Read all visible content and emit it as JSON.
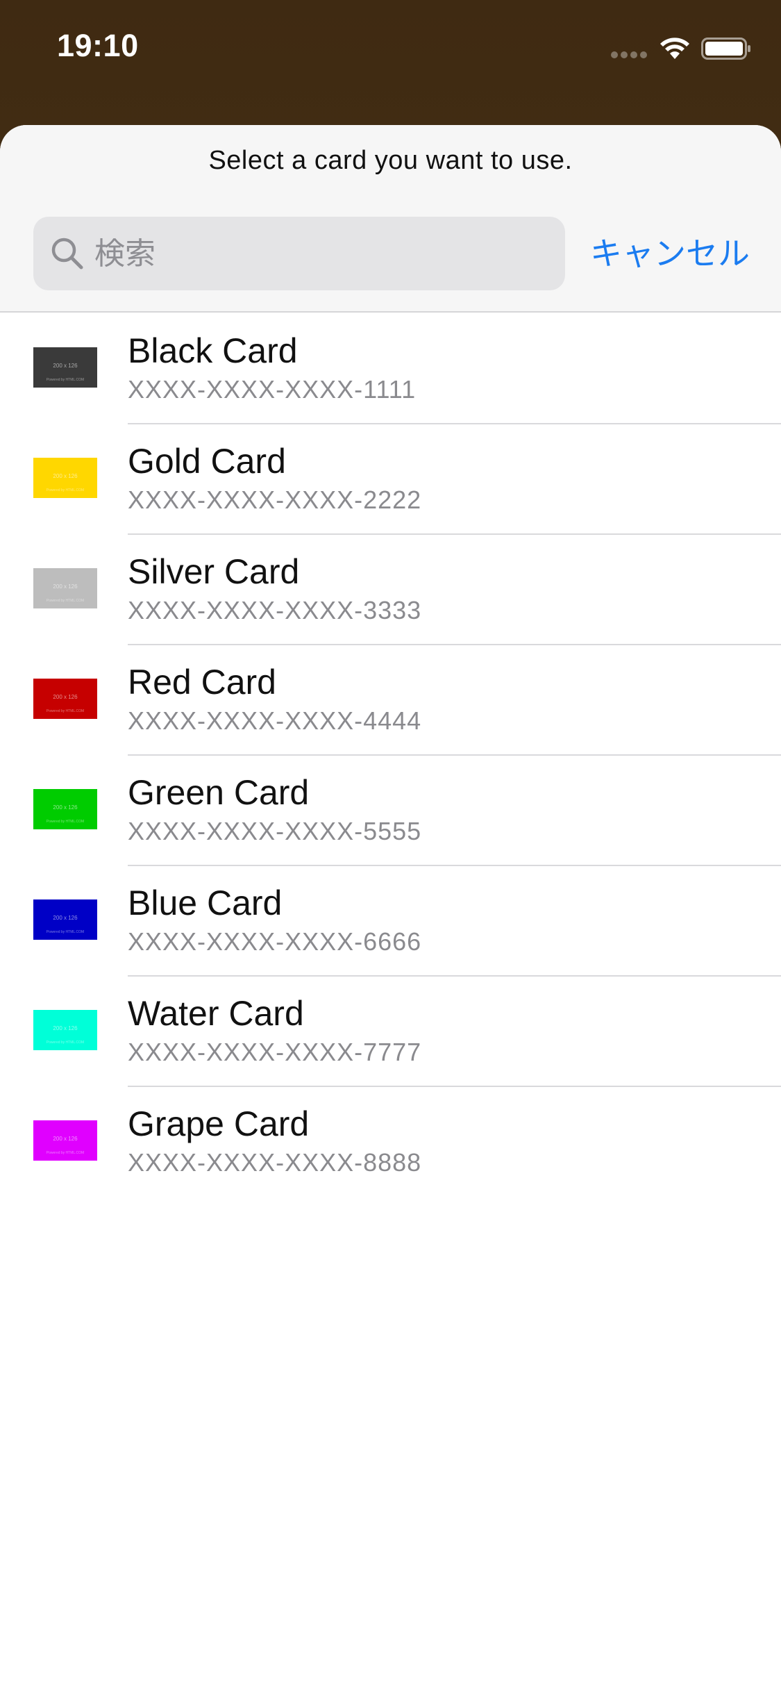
{
  "status_bar": {
    "time": "19:10"
  },
  "sheet": {
    "prompt": "Select a card you want to use.",
    "search": {
      "placeholder": "検索",
      "value": ""
    },
    "cancel_label": "キャンセル",
    "cancel_color": "#1b7cf0"
  },
  "cards": [
    {
      "name": "Black Card",
      "number": "XXXX-XXXX-XXXX-1111",
      "color": "#3a3a3a",
      "thumb_text": "200 x 126",
      "thumb_sub": "Powered by HTML.COM"
    },
    {
      "name": "Gold Card",
      "number": "XXXX-XXXX-XXXX-2222",
      "color": "#ffd700",
      "thumb_text": "200 x 126",
      "thumb_sub": "Powered by HTML.COM"
    },
    {
      "name": "Silver Card",
      "number": "XXXX-XXXX-XXXX-3333",
      "color": "#bdbdbd",
      "thumb_text": "200 x 126",
      "thumb_sub": "Powered by HTML.COM"
    },
    {
      "name": "Red Card",
      "number": "XXXX-XXXX-XXXX-4444",
      "color": "#c60000",
      "thumb_text": "200 x 126",
      "thumb_sub": "Powered by HTML.COM"
    },
    {
      "name": "Green Card",
      "number": "XXXX-XXXX-XXXX-5555",
      "color": "#00cc00",
      "thumb_text": "200 x 126",
      "thumb_sub": "Powered by HTML.COM"
    },
    {
      "name": "Blue Card",
      "number": "XXXX-XXXX-XXXX-6666",
      "color": "#0000c6",
      "thumb_text": "200 x 126",
      "thumb_sub": "Powered by HTML.COM"
    },
    {
      "name": "Water Card",
      "number": "XXXX-XXXX-XXXX-7777",
      "color": "#00ffd8",
      "thumb_text": "200 x 126",
      "thumb_sub": "Powered by HTML.COM"
    },
    {
      "name": "Grape Card",
      "number": "XXXX-XXXX-XXXX-8888",
      "color": "#e000ff",
      "thumb_text": "200 x 126",
      "thumb_sub": "Powered by HTML.COM"
    }
  ]
}
